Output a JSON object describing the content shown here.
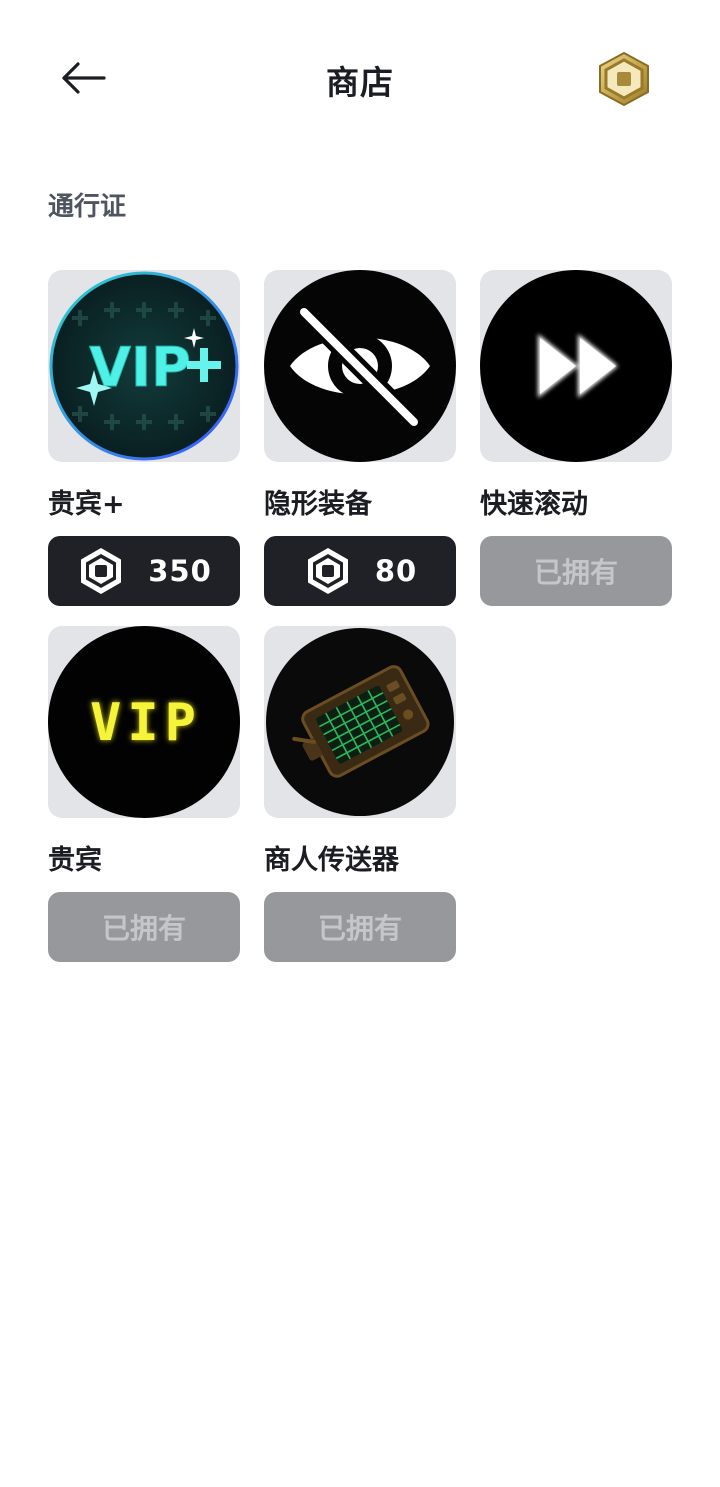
{
  "header": {
    "title": "商店",
    "back_icon": "arrow-left-icon",
    "currency_icon": "robux-gold-icon"
  },
  "section": {
    "title": "通行证"
  },
  "colors": {
    "buy_button_bg": "#1f2126",
    "owned_button_bg": "#96989c",
    "thumb_bg": "#e3e4e8"
  },
  "items": [
    {
      "name": "贵宾+",
      "thumb_icon": "vip-plus-icon",
      "status": "buy",
      "price": "350",
      "price_icon": "robux-icon"
    },
    {
      "name": "隐形装备",
      "thumb_icon": "eye-slash-icon",
      "status": "buy",
      "price": "80",
      "price_icon": "robux-icon"
    },
    {
      "name": "快速滚动",
      "thumb_icon": "fast-forward-icon",
      "status": "owned",
      "owned_label": "已拥有"
    },
    {
      "name": "贵宾",
      "thumb_icon": "vip-icon",
      "status": "owned",
      "owned_label": "已拥有"
    },
    {
      "name": "商人传送器",
      "thumb_icon": "teleporter-device-icon",
      "status": "owned",
      "owned_label": "已拥有"
    }
  ]
}
